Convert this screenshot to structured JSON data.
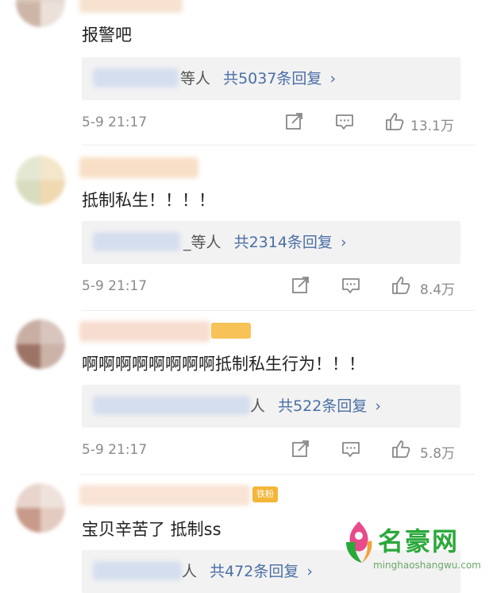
{
  "comments": [
    {
      "text": "报警吧",
      "reply_suffix": "等人",
      "reply_count": "共5037条回复",
      "chevron": "›",
      "time": "5-9 21:17",
      "likes": "13.1万"
    },
    {
      "text": "抵制私生！！！！",
      "reply_suffix": "_等人",
      "reply_count": "共2314条回复",
      "chevron": "›",
      "time": "5-9 21:17",
      "likes": "8.4万"
    },
    {
      "text": "啊啊啊啊啊啊啊啊抵制私生行为！！！",
      "reply_suffix": "人",
      "reply_count": "共522条回复",
      "chevron": "›",
      "time": "5-9 21:17",
      "likes": "5.8万"
    },
    {
      "text": "宝贝辛苦了 抵制ss",
      "badge": "铁粉",
      "reply_suffix": "人",
      "reply_count": "共472条回复",
      "chevron": "›"
    }
  ],
  "watermark": {
    "title": "名豪网",
    "url": "minghaoshangwu.com"
  },
  "colors": {
    "accent": "#4a6fa5",
    "meta_text": "#8a8a8a",
    "reply_bg": "#f2f2f2",
    "badge": "#f5b538",
    "watermark_green": "#2aa83a"
  },
  "icons": [
    "share-icon",
    "comment-icon",
    "like-icon",
    "chevron-right-icon"
  ]
}
